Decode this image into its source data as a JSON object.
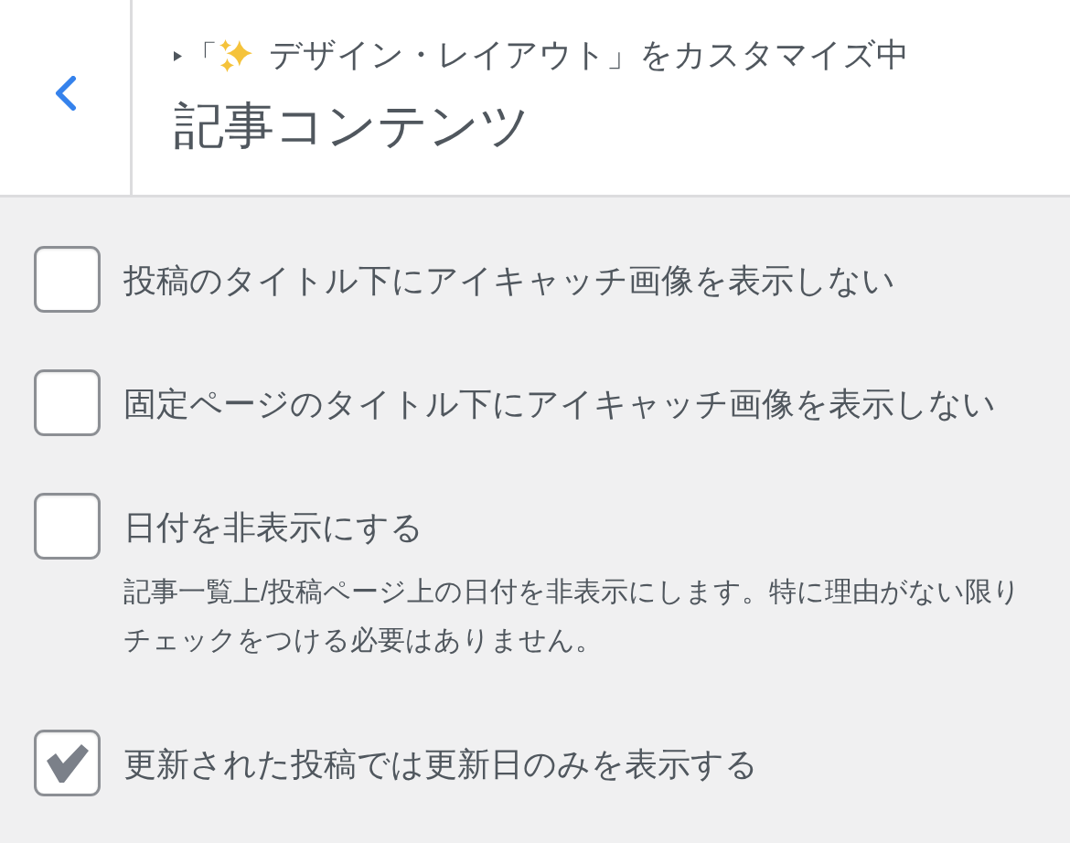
{
  "header": {
    "breadcrumb_open": "「",
    "breadcrumb_text": "デザイン・レイアウト」をカスタマイズ中",
    "title": "記事コンテンツ"
  },
  "options": [
    {
      "label": "投稿のタイトル下にアイキャッチ画像を表示しない",
      "checked": false
    },
    {
      "label": "固定ページのタイトル下にアイキャッチ画像を表示しない",
      "checked": false
    },
    {
      "label": "日付を非表示にする",
      "checked": false,
      "description": "記事一覧上/投稿ページ上の日付を非表示にします。特に理由がない限りチェックをつける必要はありません。"
    },
    {
      "label": "更新された投稿では更新日のみを表示する",
      "checked": true
    }
  ]
}
